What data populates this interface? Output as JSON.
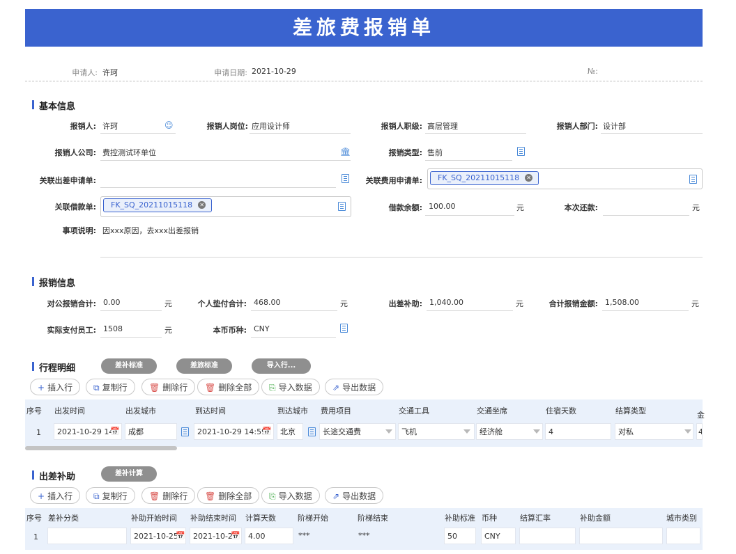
{
  "title": "差旅费报销单",
  "header": {
    "applicant_label": "申请人:",
    "applicant": "许珂",
    "date_label": "申请日期:",
    "date": "2021-10-29",
    "no_label": "№:"
  },
  "basic": {
    "title": "基本信息",
    "claimant_label": "报销人:",
    "claimant": "许珂",
    "position_label": "报销人岗位:",
    "position": "应用设计师",
    "rank_label": "报销人职级:",
    "rank": "高层管理",
    "dept_label": "报销人部门:",
    "dept": "设计部",
    "company_label": "报销人公司:",
    "company": "费控测试环单位",
    "type_label": "报销类型:",
    "type": "售前",
    "trip_req_label": "关联出差申请单:",
    "expense_req_label": "关联费用申请单:",
    "expense_req_tag": "FK_SQ_20211015118",
    "loan_label": "关联借款单:",
    "loan_tag": "FK_SQ_20211015118",
    "loan_balance_label": "借款余额:",
    "loan_balance": "100.00",
    "unit": "元",
    "repay_label": "本次还款:",
    "desc_label": "事项说明:",
    "desc": "因xxx原因，去xxx出差报销"
  },
  "reimb": {
    "title": "报销信息",
    "corp_total_label": "对公报销合计:",
    "corp_total": "0.00",
    "personal_total_label": "个人垫付合计:",
    "personal_total": "468.00",
    "allowance_label": "出差补助:",
    "allowance": "1,040.00",
    "total_label": "合计报销金额:",
    "total": "1,508.00",
    "actual_paid_label": "实际支付员工:",
    "actual_paid": "1508",
    "currency_label": "本币币种:",
    "currency": "CNY",
    "unit": "元"
  },
  "trip": {
    "title": "行程明细",
    "btn_standard": "差补标准",
    "btn_travel_standard": "差旅标准",
    "btn_import_row": "导入行...",
    "toolbar": [
      "插入行",
      "复制行",
      "删除行",
      "删除全部",
      "导入数据",
      "导出数据"
    ],
    "columns": [
      "序号",
      "出发时间",
      "出发城市",
      "到达时间",
      "到达城市",
      "费用项目",
      "交通工具",
      "交通坐席",
      "住宿天数",
      "结算类型",
      "金"
    ],
    "row": {
      "no": "1",
      "depart_time": "2021-10-29 14",
      "depart_city": "成都",
      "arrive_time": "2021-10-29 14:59",
      "arrive_city": "北京",
      "item": "长途交通费",
      "vehicle": "飞机",
      "seat": "经济舱",
      "nights": "4",
      "settle": "对私",
      "amount": "4"
    }
  },
  "allowance": {
    "title": "出差补助",
    "btn_calc": "差补计算",
    "toolbar": [
      "插入行",
      "复制行",
      "删除行",
      "删除全部",
      "导入数据",
      "导出数据"
    ],
    "columns": [
      "序号",
      "差补分类",
      "补助开始时间",
      "补助结束时间",
      "计算天数",
      "阶梯开始",
      "阶梯结束",
      "补助标准",
      "币种",
      "结算汇率",
      "补助金额",
      "城市类别"
    ],
    "row": {
      "no": "1",
      "category": "",
      "start": "2021-10-25",
      "end": "2021-10-2",
      "days": "4.00",
      "step_start": "***",
      "step_end": "***",
      "standard": "50",
      "currency": "CNY",
      "rate": "",
      "amount": "",
      "city_type": ""
    }
  }
}
